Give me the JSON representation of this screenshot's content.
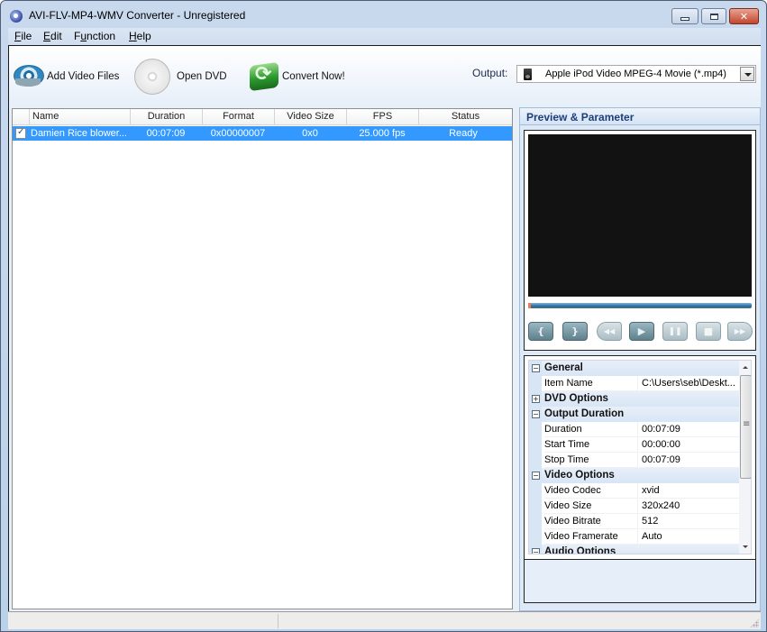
{
  "window": {
    "title": "AVI-FLV-MP4-WMV Converter - Unregistered",
    "controls": {
      "minimize": "minimize",
      "maximize": "maximize",
      "close": "✕"
    }
  },
  "menu": {
    "items": [
      {
        "label": "File",
        "accel": "F",
        "rest": "ile"
      },
      {
        "label": "Edit",
        "accel": "E",
        "rest": "dit"
      },
      {
        "label": "Function",
        "accel_pre": "F",
        "accel": "u",
        "rest": "nction"
      },
      {
        "label": "Help",
        "accel": "H",
        "rest": "elp"
      }
    ]
  },
  "toolbar": {
    "add_video": {
      "label": "Add Video Files",
      "icon": "film-reel-icon"
    },
    "open_dvd": {
      "label": "Open DVD",
      "icon": "dvd-disc-icon"
    },
    "convert": {
      "label": "Convert Now!",
      "icon": "convert-arrows-icon"
    },
    "output": {
      "label": "Output:",
      "value": "Apple iPod Video MPEG-4 Movie (*.mp4)",
      "icon": "ipod-icon"
    }
  },
  "file_list": {
    "columns": [
      "Name",
      "Duration",
      "Format",
      "Video Size",
      "FPS",
      "Status"
    ],
    "rows": [
      {
        "checked": true,
        "name": "Damien Rice blower...",
        "duration": "00:07:09",
        "format": "0x00000007",
        "video_size": "0x0",
        "fps": "25.000 fps",
        "status": "Ready",
        "selected": true
      }
    ]
  },
  "preview": {
    "title": "Preview & Parameter",
    "progress": 0,
    "controls": [
      {
        "name": "mark-start",
        "glyph": "{"
      },
      {
        "name": "mark-end",
        "glyph": "}"
      },
      {
        "name": "rewind",
        "glyph": "◀◀"
      },
      {
        "name": "play",
        "glyph": "▶"
      },
      {
        "name": "pause",
        "glyph": "❚❚"
      },
      {
        "name": "stop",
        "glyph": "■"
      },
      {
        "name": "fast-forward",
        "glyph": "▶▶"
      }
    ]
  },
  "parameters": {
    "rows": [
      {
        "type": "category",
        "label": "General",
        "expander": "−"
      },
      {
        "type": "prop",
        "name": "Item Name",
        "value": "C:\\Users\\seb\\Deskt..."
      },
      {
        "type": "category",
        "label": "DVD Options",
        "expander": "+"
      },
      {
        "type": "category",
        "label": "Output Duration",
        "expander": "−"
      },
      {
        "type": "prop",
        "name": "Duration",
        "value": "00:07:09"
      },
      {
        "type": "prop",
        "name": "Start Time",
        "value": "00:00:00"
      },
      {
        "type": "prop",
        "name": "Stop Time",
        "value": "00:07:09"
      },
      {
        "type": "category",
        "label": "Video Options",
        "expander": "−"
      },
      {
        "type": "prop",
        "name": "Video Codec",
        "value": "xvid"
      },
      {
        "type": "prop",
        "name": "Video Size",
        "value": "320x240"
      },
      {
        "type": "prop",
        "name": "Video Bitrate",
        "value": "512"
      },
      {
        "type": "prop",
        "name": "Video Framerate",
        "value": "Auto"
      },
      {
        "type": "category",
        "label": "Audio Options",
        "expander": "−"
      }
    ]
  },
  "statusbar": {
    "left": "",
    "right": ""
  }
}
